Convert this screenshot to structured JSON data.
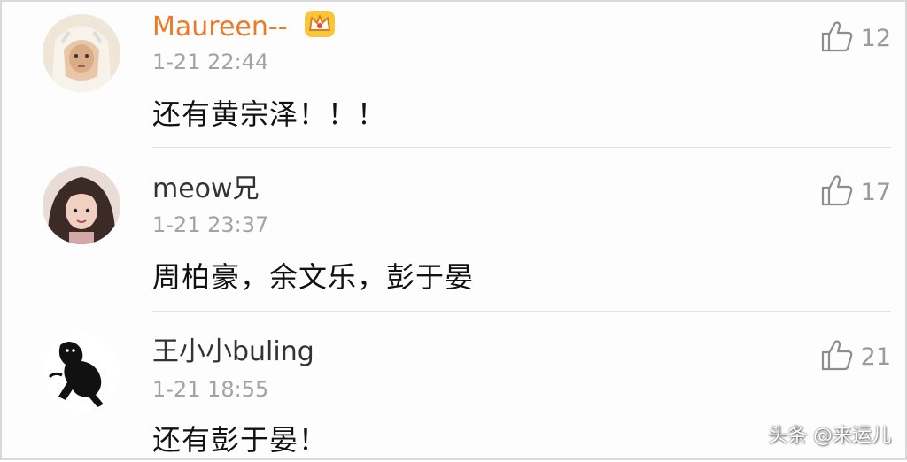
{
  "comments": [
    {
      "username": "Maureen--",
      "badge_icon": "crown-icon",
      "time": "1-21 22:44",
      "text": "还有黄宗泽！！！",
      "likes": "12"
    },
    {
      "username": "meow兄",
      "time": "1-21 23:37",
      "text": "周柏豪，余文乐，彭于晏",
      "likes": "17"
    },
    {
      "username": "王小小buling",
      "time": "1-21 18:55",
      "text": "还有彭于晏！",
      "likes": "21"
    }
  ],
  "like_icon": "thumbs-up-icon",
  "watermark": "头条 @来运儿",
  "colors": {
    "vip_name": "#ec7a2c",
    "name": "#333333",
    "time": "#a3a3a3",
    "like": "#9b9b9b"
  }
}
